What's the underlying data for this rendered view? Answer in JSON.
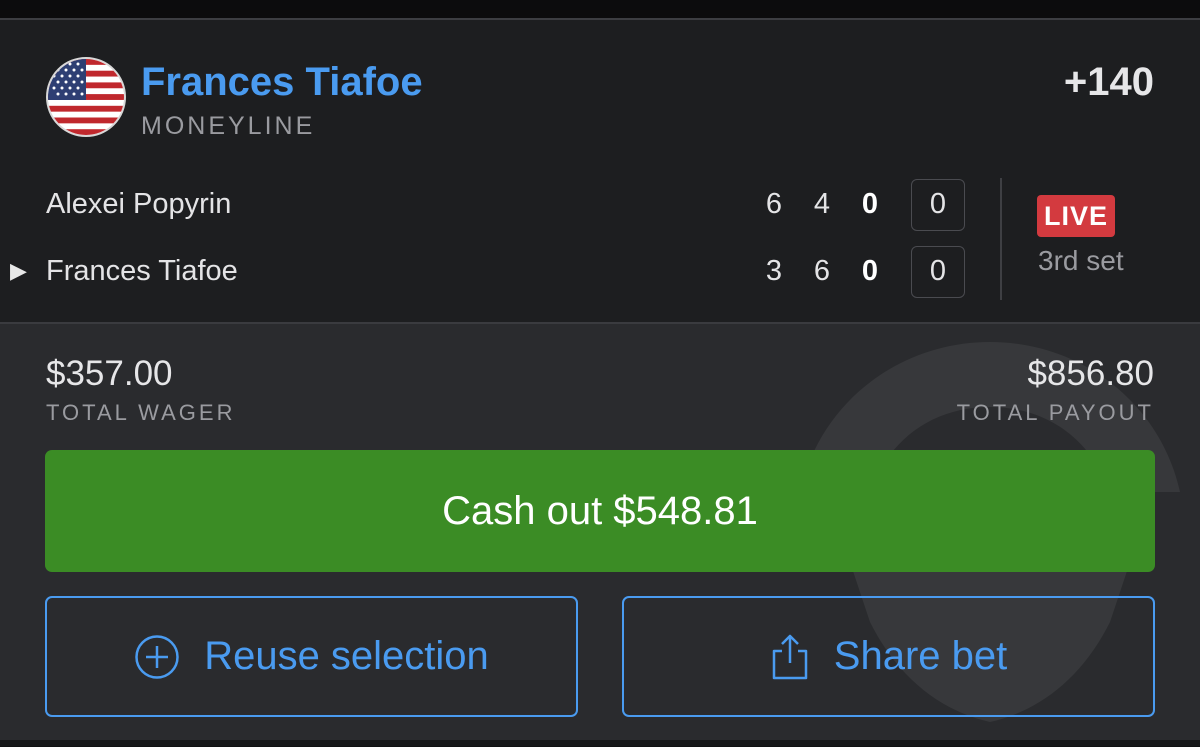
{
  "selection": {
    "name": "Frances Tiafoe",
    "market": "MONEYLINE",
    "odds": "+140",
    "flag_icon": "usa-flag-icon"
  },
  "scoreboard": {
    "players": [
      {
        "name": "Alexei Popyrin",
        "sets": [
          "6",
          "4",
          "0"
        ],
        "game": "0",
        "serving": false
      },
      {
        "name": "Frances Tiafoe",
        "sets": [
          "3",
          "6",
          "0"
        ],
        "game": "0",
        "serving": true
      }
    ],
    "status": {
      "badge": "LIVE",
      "period": "3rd set"
    }
  },
  "wager": {
    "amount": "$357.00",
    "label": "TOTAL WAGER"
  },
  "payout": {
    "amount": "$856.80",
    "label": "TOTAL PAYOUT"
  },
  "actions": {
    "cashout_label": "Cash out $548.81",
    "reuse_label": "Reuse selection",
    "share_label": "Share bet"
  },
  "colors": {
    "accent_blue": "#4a9bf0",
    "cashout_green": "#3b8c25",
    "live_red": "#d33a3f",
    "background": "#2a2b2e",
    "header_background": "#1d1e20"
  }
}
